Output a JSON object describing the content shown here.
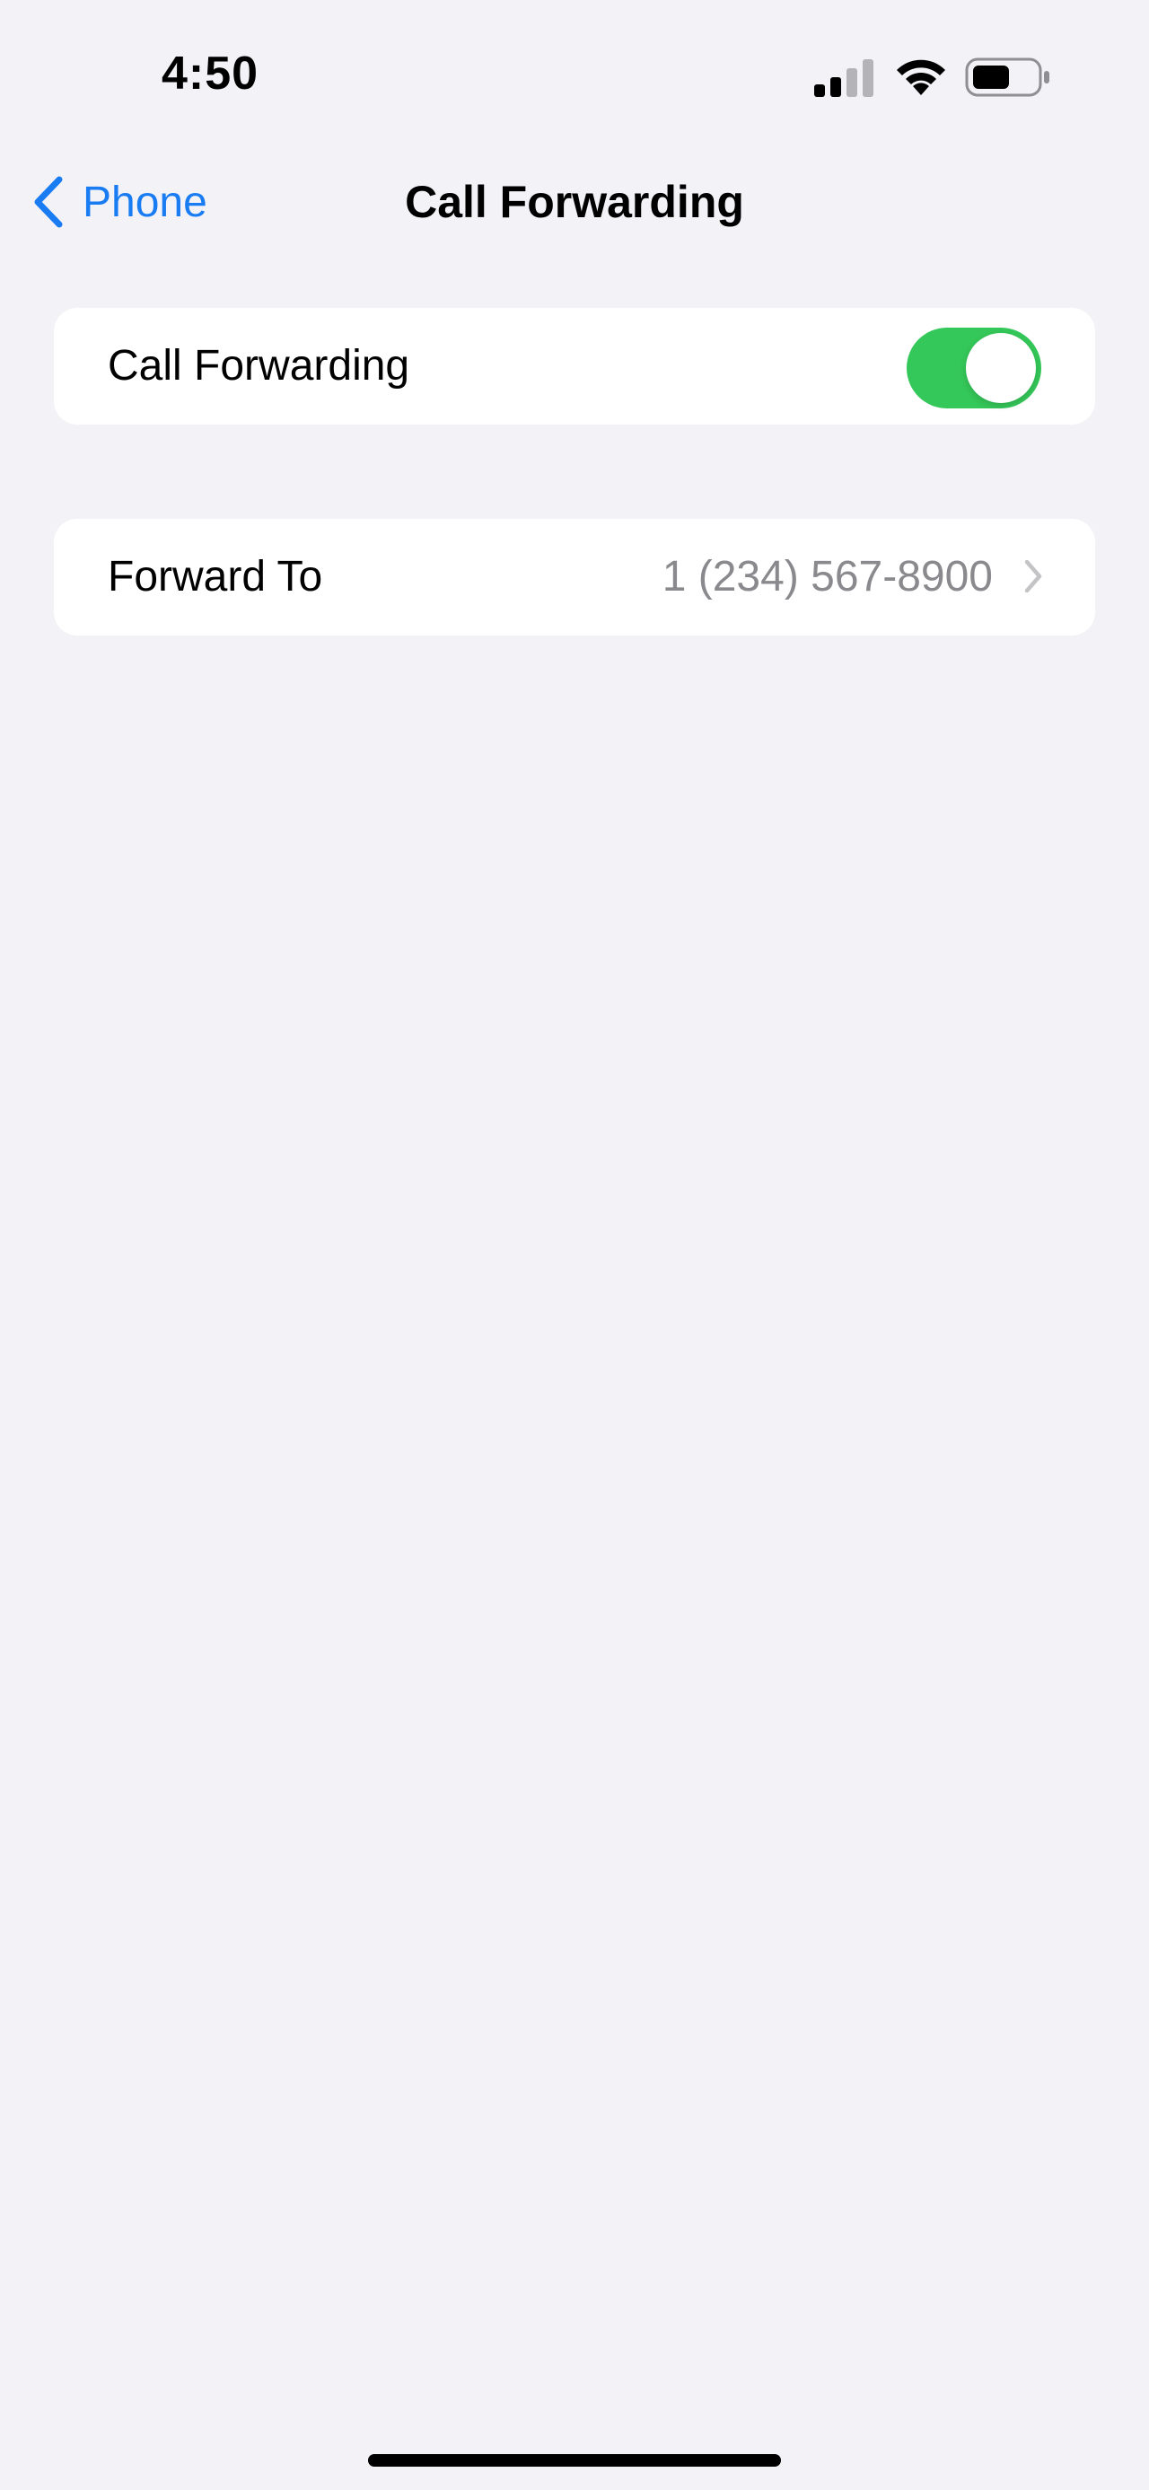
{
  "status_bar": {
    "time": "4:50",
    "icons": [
      "cellular-signal-icon",
      "wifi-icon",
      "battery-icon"
    ]
  },
  "nav": {
    "back_label": "Phone",
    "title": "Call Forwarding"
  },
  "settings": {
    "call_forwarding": {
      "label": "Call Forwarding",
      "enabled": true
    },
    "forward_to": {
      "label": "Forward To",
      "value": "1 (234) 567-8900"
    }
  },
  "colors": {
    "background": "#f2f2f7",
    "accent": "#1a7cf2",
    "toggle_on": "#34c759",
    "secondary_text": "#8a8a8e"
  }
}
